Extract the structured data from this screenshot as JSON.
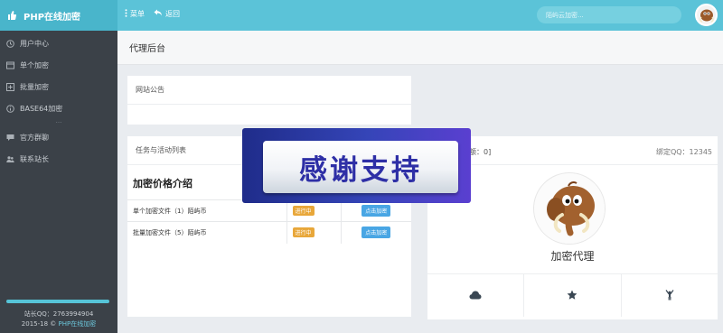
{
  "header": {
    "brand": "PHP在线加密",
    "menu_label": "菜单",
    "back_label": "返回",
    "search_placeholder": "陌屿云加密..."
  },
  "sidebar": {
    "items": [
      {
        "label": "用户中心",
        "icon": "clock-icon"
      },
      {
        "label": "单个加密",
        "icon": "window-icon"
      },
      {
        "label": "批量加密",
        "icon": "plus-square-icon"
      },
      {
        "label": "BASE64加密",
        "icon": "info-icon"
      }
    ],
    "dots": "···",
    "items2": [
      {
        "label": "官方群聊",
        "icon": "chat-icon"
      },
      {
        "label": "联系站长",
        "icon": "user-group-icon"
      }
    ],
    "footer_qq": "站长QQ：2763994904",
    "footer_copyright_prefix": "2015-18 ©",
    "footer_copyright_link": "PHP在线加密"
  },
  "main": {
    "breadcrumb": "代理后台",
    "notice_title": "网站公告",
    "tasks_title": "任务与活动列表",
    "pricing_title": "加密价格介绍",
    "pricing_rows": [
      {
        "name": "单个加密文件（1）陌屿币",
        "status": "进行中",
        "action": "点击加密"
      },
      {
        "name": "批量加密文件（5）陌屿币",
        "status": "进行中",
        "action": "点击加密"
      }
    ],
    "agent_header_left": "余额：0]",
    "agent_header_right": "绑定QQ：12345",
    "agent_name": "加密代理"
  },
  "banner": {
    "text": "感谢支持"
  },
  "colors": {
    "topbar": "#5bc3d8",
    "sidebar": "#3b4148",
    "badge": "#e8a73a",
    "button": "#49a6e4",
    "banner_text": "#2e2fa6"
  }
}
